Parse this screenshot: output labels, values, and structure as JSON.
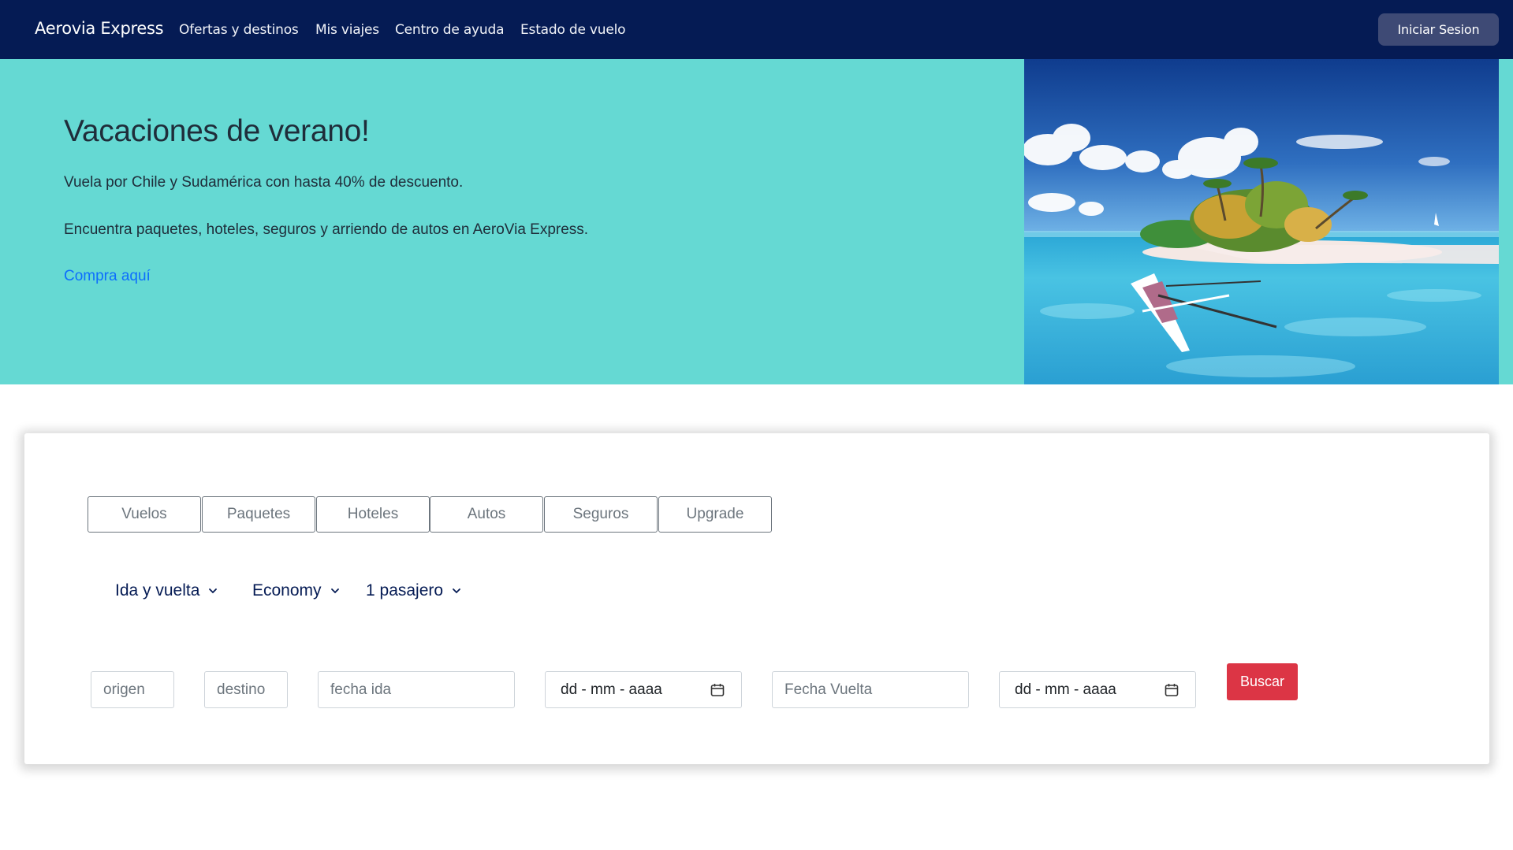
{
  "navbar": {
    "brand": "Aerovia Express",
    "links": [
      "Ofertas y destinos",
      "Mis viajes",
      "Centro de ayuda",
      "Estado de vuelo"
    ],
    "login_label": "Iniciar Sesion"
  },
  "hero": {
    "title": "Vacaciones de verano!",
    "line1": "Vuela por Chile y Sudamérica con hasta 40% de descuento.",
    "line2": "Encuentra paquetes, hoteles, seguros y arriendo de autos en AeroVia Express.",
    "cta": "Compra aquí"
  },
  "search": {
    "tabs": [
      "Vuelos",
      "Paquetes",
      "Hoteles",
      "Autos",
      "Seguros",
      "Upgrade"
    ],
    "dropdowns": [
      "Ida y vuelta",
      "Economy",
      "1 pasajero"
    ],
    "origen_placeholder": "origen",
    "destino_placeholder": "destino",
    "fecha_ida_placeholder": "fecha ida",
    "date_ida_text": "dd - mm - aaaa",
    "fecha_vuelta_placeholder": "Fecha Vuelta",
    "date_vuelta_text": "dd - mm - aaaa",
    "buscar_label": "Buscar"
  },
  "colors": {
    "navbar_bg": "#051b54",
    "hero_bg": "#65d9d3",
    "login_bg": "#3e4a75",
    "buscar_bg": "#dc3545",
    "link": "#0d6efd"
  },
  "icons": [
    "chevron-down-icon",
    "calendar-icon"
  ]
}
